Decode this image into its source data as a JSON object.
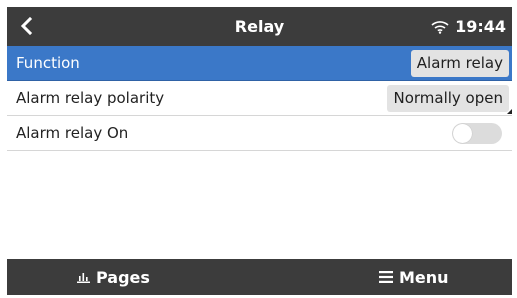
{
  "header": {
    "title": "Relay",
    "time": "19:44",
    "back_icon": "chevron-left-icon",
    "wifi_icon": "wifi-icon"
  },
  "settings": [
    {
      "label": "Function",
      "value": "Alarm relay",
      "selected": true
    },
    {
      "label": "Alarm relay polarity",
      "value": "Normally open"
    },
    {
      "label": "Alarm relay On",
      "toggle": false
    }
  ],
  "footer": {
    "pages_label": "Pages",
    "pages_icon": "pages-chart-icon",
    "menu_label": "Menu",
    "menu_icon": "hamburger-menu-icon"
  },
  "colors": {
    "header_bg": "#3c3c3c",
    "selected_row": "#3b78c8"
  }
}
